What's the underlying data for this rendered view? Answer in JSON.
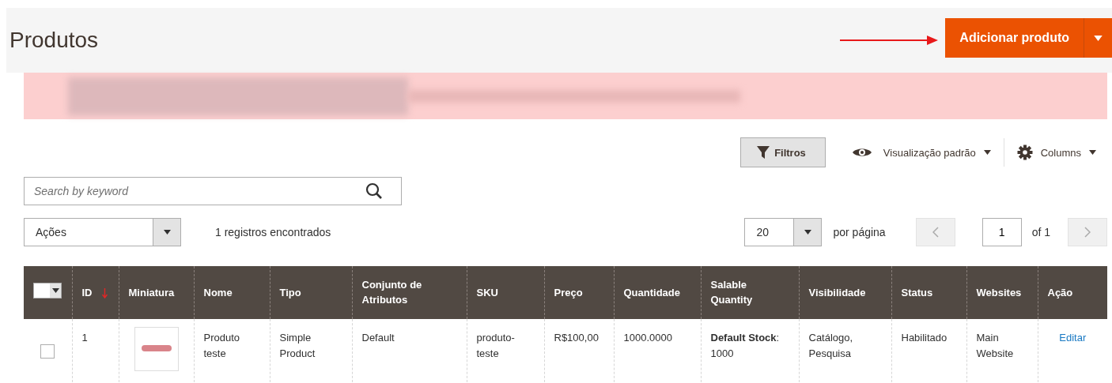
{
  "page_header": {
    "title": "Produtos",
    "add_button": {
      "label": "Adicionar produto"
    }
  },
  "toolbar": {
    "filters_button": "Filtros",
    "view_menu": "Visualização padrão",
    "columns_menu": "Columns"
  },
  "search": {
    "placeholder": "Search by keyword"
  },
  "actions": {
    "select": "Ações",
    "records_found": "1 registros encontrados"
  },
  "pagination": {
    "page_size": "20",
    "per_page_label": "por página",
    "page": "1",
    "of_pages": "of 1"
  },
  "table": {
    "select_all": {
      "checked": false
    },
    "columns": [
      {
        "label": "ID",
        "sorted": true
      },
      {
        "label": "Miniatura",
        "sorted": false
      },
      {
        "label": "Nome",
        "sorted": false
      },
      {
        "label": "Tipo",
        "sorted": false
      },
      {
        "label": "Conjunto de Atributos",
        "sorted": false
      },
      {
        "label": "SKU",
        "sorted": false
      },
      {
        "label": "Preço",
        "sorted": false
      },
      {
        "label": "Quantidade",
        "sorted": false
      },
      {
        "label": "Salable Quantity",
        "sorted": false
      },
      {
        "label": "Visibilidade",
        "sorted": false
      },
      {
        "label": "Status",
        "sorted": false
      },
      {
        "label": "Websites",
        "sorted": false
      },
      {
        "label": "Ação",
        "sorted": false
      }
    ],
    "rows": [
      {
        "checked": false,
        "cells": [
          {
            "kind": "text",
            "text": "1"
          },
          {
            "kind": "thumbnail"
          },
          {
            "kind": "text",
            "text": "Produto teste"
          },
          {
            "kind": "text",
            "text": "Simple Product"
          },
          {
            "kind": "text",
            "text": "Default"
          },
          {
            "kind": "text",
            "text": "produto-teste"
          },
          {
            "kind": "text",
            "text": "R$100,00"
          },
          {
            "kind": "text",
            "text": "1000.0000"
          },
          {
            "kind": "text",
            "text": "**Default Stock**: 1000"
          },
          {
            "kind": "text",
            "text": "Catálogo, Pesquisa"
          },
          {
            "kind": "text",
            "text": "Habilitado"
          },
          {
            "kind": "text",
            "text": "Main Website"
          },
          {
            "kind": "link",
            "text": "Editar"
          }
        ]
      }
    ]
  }
}
